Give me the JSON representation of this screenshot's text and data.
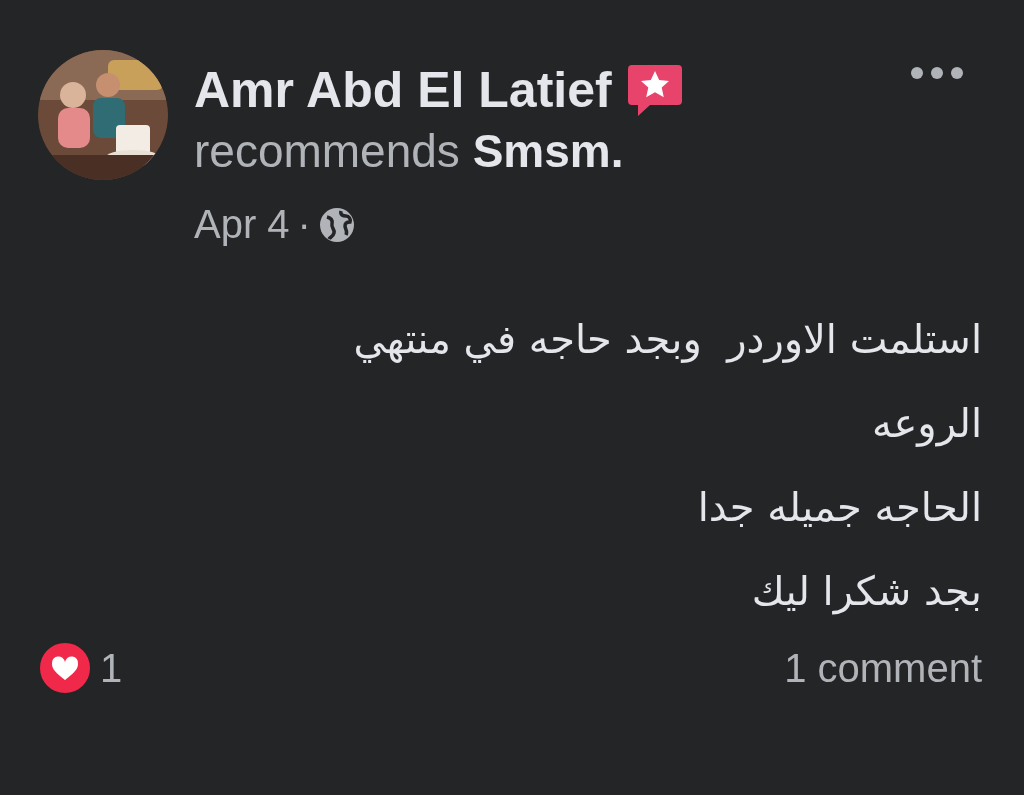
{
  "post": {
    "author": "Amr Abd El Latief",
    "headline": "recommends **Smsm.**",
    "date": "Apr 4",
    "separator": "·",
    "body": [
      "استلمت الاوردر  وبجد حاجه في منتهي",
      "الروعه",
      "الحاجه جميله جدا",
      "بجد شكرا ليك"
    ],
    "reaction_count": "1",
    "comments": "1 comment"
  }
}
